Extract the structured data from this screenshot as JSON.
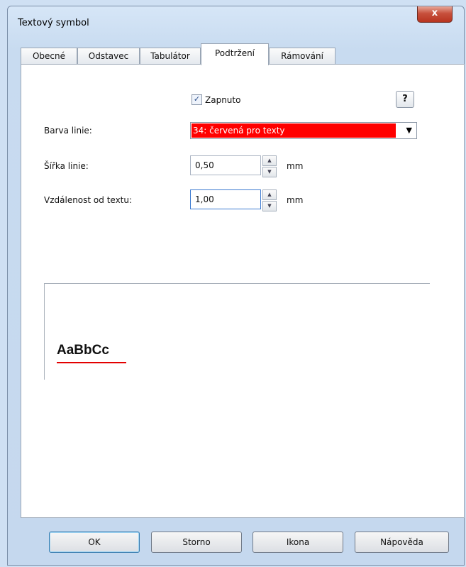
{
  "window": {
    "title": "Textový symbol",
    "close_label": "x"
  },
  "tabs": [
    {
      "label": "Obecné"
    },
    {
      "label": "Odstavec"
    },
    {
      "label": "Tabulátor"
    },
    {
      "label": "Podtržení",
      "active": true
    },
    {
      "label": "Rámování"
    }
  ],
  "underline": {
    "enabled_label": "Zapnuto",
    "enabled": true,
    "help_label": "?",
    "line_color_label": "Barva linie:",
    "line_color_value": "34: červená pro texty",
    "line_color_hex": "#ff0000",
    "line_width_label": "Šířka linie:",
    "line_width_value": "0,50",
    "distance_label": "Vzdálenost od textu:",
    "distance_value": "1,00",
    "unit": "mm"
  },
  "preview": {
    "sample_text": "AaBbCc"
  },
  "buttons": {
    "ok": "OK",
    "cancel": "Storno",
    "icon": "Ikona",
    "help": "Nápověda"
  }
}
